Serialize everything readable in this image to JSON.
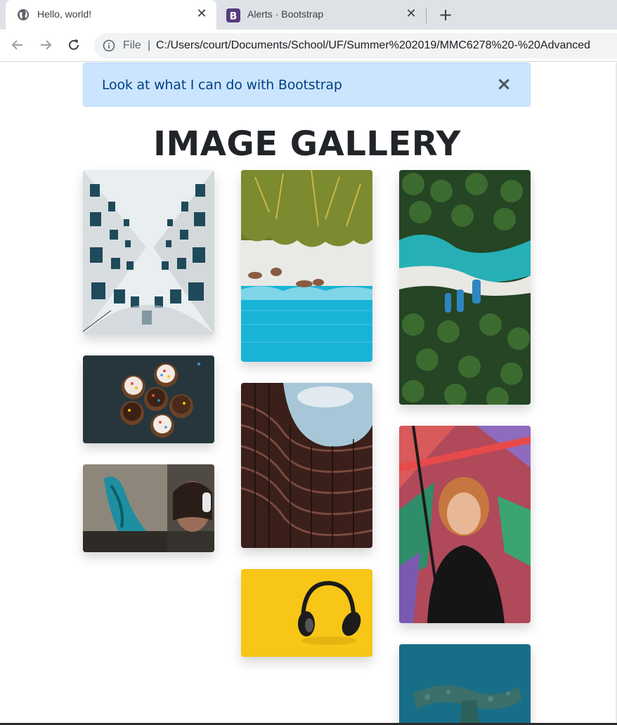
{
  "browser": {
    "tabs": [
      {
        "title": "Hello, world!",
        "icon": "globe-icon",
        "active": true
      },
      {
        "title": "Alerts · Bootstrap",
        "icon": "bootstrap-icon",
        "active": false
      }
    ],
    "new_tab": "+",
    "omnibox": {
      "scheme": "File",
      "separator": "|",
      "url": "C:/Users/court/Documents/School/UF/Summer%202019/MMC6278%20-%20Advanced"
    }
  },
  "alert": {
    "message": "Look at what I can do with Bootstrap",
    "close": "×",
    "bg_color": "#cce5ff",
    "text_color": "#004085"
  },
  "heading": "IMAGE GALLERY",
  "gallery": {
    "columns": [
      {
        "images": [
          {
            "icon": "architecture-photo"
          },
          {
            "icon": "cupcakes-photo"
          },
          {
            "icon": "graffiti-headphones-photo"
          }
        ]
      },
      {
        "images": [
          {
            "icon": "aerial-beach-photo"
          },
          {
            "icon": "curved-building-photo"
          },
          {
            "icon": "yellow-headphones-photo"
          }
        ]
      },
      {
        "images": [
          {
            "icon": "palm-beach-boats-photo"
          },
          {
            "icon": "mural-portrait-photo"
          },
          {
            "icon": "underwater-reef-photo"
          }
        ]
      }
    ]
  }
}
